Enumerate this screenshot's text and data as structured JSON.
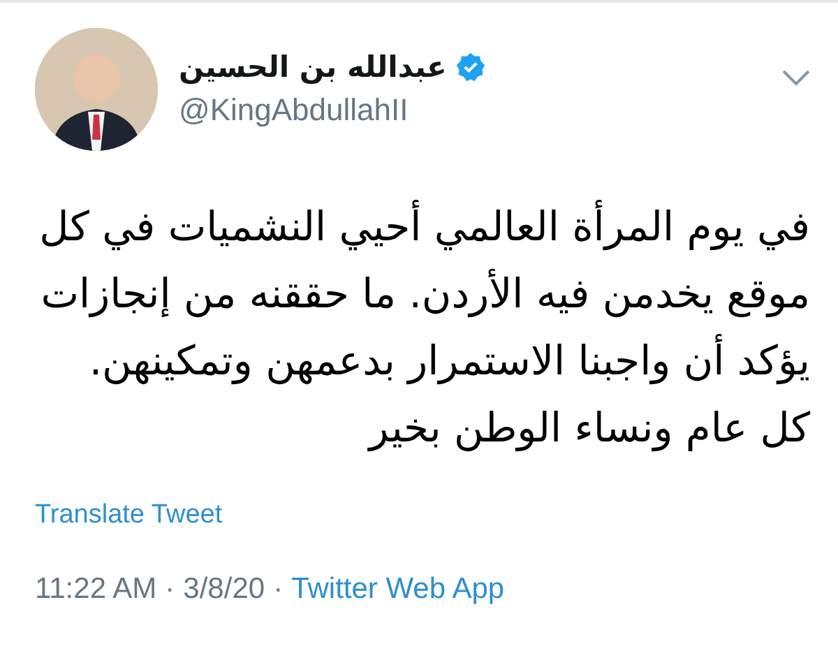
{
  "author": {
    "name": "عبدالله بن الحسين",
    "verified": true,
    "handle": "@KingAbdullahII"
  },
  "tweet": {
    "paragraphs": [
      "في يوم المرأة العالمي أحيي النشميات في كل موقع يخدمن فيه الأردن. ما حققنه من إنجازات يؤكد أن واجبنا الاستمرار بدعمهن وتمكينهن.",
      "كل عام ونساء الوطن بخير"
    ]
  },
  "translate_link": "Translate Tweet",
  "meta": {
    "time": "11:22 AM",
    "separator_1": "·",
    "date": "3/8/20",
    "separator_2": "·",
    "source": "Twitter Web App"
  }
}
